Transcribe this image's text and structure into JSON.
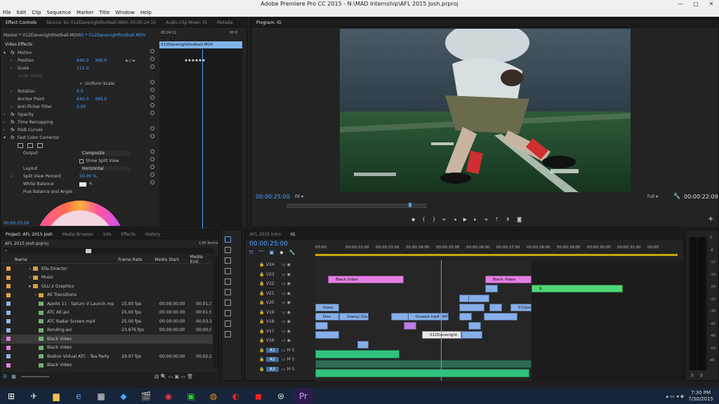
{
  "window": {
    "title": "Adobe Premiere Pro CC 2015 - N:\\MAD Internship\\AFL 2015 Josh.prproj",
    "controls": [
      "—",
      "□",
      "✕"
    ]
  },
  "menu": [
    "File",
    "Edit",
    "Clip",
    "Sequence",
    "Marker",
    "Title",
    "Window",
    "Help"
  ],
  "effect_controls": {
    "tabs": [
      "Effect Controls",
      "Source: IG: 012Danenightfootball.MOV: 00:00:24:10",
      "Audio Clip Mixer: IG",
      "Metada"
    ],
    "master": "Master * 012Danenightfootball.MOV",
    "clip": "IG * 012Danenightfootball.MOV",
    "mini_time": "00:24:12",
    "mini_time2": "00:0",
    "mini_clip": "012Danenightfootball.MOV",
    "section": "Video Effects",
    "props": [
      {
        "name": "Motion",
        "fx": true,
        "value": "",
        "value2": ""
      },
      {
        "name": "Position",
        "fx": false,
        "value": "640.0",
        "value2": "360.0"
      },
      {
        "name": "Scale",
        "fx": false,
        "value": "111.0",
        "value2": ""
      },
      {
        "name": "Scale Width",
        "fx": false,
        "value": "",
        "value2": ""
      },
      {
        "name": "Uniform Scale",
        "fx": false,
        "value": "",
        "value2": ""
      },
      {
        "name": "Rotation",
        "fx": false,
        "value": "0.0",
        "value2": ""
      },
      {
        "name": "Anchor Point",
        "fx": false,
        "value": "640.0",
        "value2": "360.0"
      },
      {
        "name": "Anti-flicker Filter",
        "fx": false,
        "value": "0.00",
        "value2": ""
      },
      {
        "name": "Opacity",
        "fx": true,
        "value": "",
        "value2": ""
      },
      {
        "name": "Time Remapping",
        "fx": true,
        "value": "",
        "value2": ""
      },
      {
        "name": "RGB Curves",
        "fx": true,
        "value": "",
        "value2": ""
      },
      {
        "name": "Fast Color Corrector",
        "fx": true,
        "value": "",
        "value2": ""
      }
    ],
    "output_label": "Output",
    "output_value": "Composite",
    "show_split": "Show Split View",
    "layout_label": "Layout",
    "layout_value": "Horizontal",
    "split_percent_label": "Split View Percent",
    "split_percent_value": "50.00 %",
    "white_balance": "White Balance",
    "hue_balance": "Hue Balance and Angle",
    "timecode": "00:00:25:00"
  },
  "program": {
    "title": "Program: IG",
    "timecode": "00:00:25:00",
    "fit": "Fit",
    "full": "Full",
    "duration": "00:00:22:09"
  },
  "project": {
    "tabs": [
      "Project: AFL 2015 Josh",
      "Media Browser",
      "Info",
      "Effects",
      "History"
    ],
    "file": "AFL 2015 Josh.prproj",
    "items": "136 Items",
    "columns": [
      "Name",
      "Frame Rate",
      "Media Start",
      "Media End"
    ],
    "rows": [
      {
        "indent": 3,
        "type": "folder",
        "name": "Ella Director",
        "fps": "",
        "start": "",
        "end": "",
        "color": "#e8a23a"
      },
      {
        "indent": 3,
        "type": "folder",
        "name": "Music",
        "fps": "",
        "start": "",
        "end": "",
        "color": "#e8a23a"
      },
      {
        "indent": 3,
        "type": "folder",
        "name": "OLU 2 Graphics",
        "fps": "",
        "start": "",
        "end": "",
        "color": "#e8a23a"
      },
      {
        "indent": 4,
        "type": "folder",
        "name": "AE Transitions",
        "fps": "",
        "start": "",
        "end": "",
        "color": "#e8a23a"
      },
      {
        "indent": 4,
        "type": "file",
        "name": "Apollo 11 - Saturn V Launch.mp",
        "fps": "15.00 fps",
        "start": "00;00;00;00",
        "end": "00;01;3",
        "color": "#8db4e8"
      },
      {
        "indent": 4,
        "type": "file",
        "name": "ATC AE.avi",
        "fps": "25.00 fps",
        "start": "00:00:00:00",
        "end": "00:01:0",
        "color": "#8db4e8"
      },
      {
        "indent": 4,
        "type": "file",
        "name": "ATC Radar Screen.mp4",
        "fps": "25.00 fps",
        "start": "00:00:00:00",
        "end": "00:03:1",
        "color": "#8db4e8"
      },
      {
        "indent": 4,
        "type": "file",
        "name": "Bending.avi",
        "fps": "23.976 fps",
        "start": "00;00;00;00",
        "end": "00;00;0",
        "color": "#8db4e8"
      },
      {
        "indent": 4,
        "type": "file",
        "name": "Black Video",
        "fps": "",
        "start": "",
        "end": "",
        "color": "#e57fe3"
      },
      {
        "indent": 4,
        "type": "file",
        "name": "Black Video",
        "fps": "",
        "start": "",
        "end": "",
        "color": "#e57fe3"
      },
      {
        "indent": 4,
        "type": "file",
        "name": "Boston Virtual ATC - Tea Party",
        "fps": "29.97 fps",
        "start": "00;00;00;00",
        "end": "00;02;2",
        "color": "#8db4e8"
      },
      {
        "indent": 4,
        "type": "file",
        "name": "Black Video",
        "fps": "",
        "start": "",
        "end": "",
        "color": "#e57fe3"
      }
    ]
  },
  "timeline": {
    "tabs": [
      "AFL 2015 Intro",
      "IG"
    ],
    "timecode": "00:00:25:00",
    "ruler": [
      "00:00",
      "00:00:22:00",
      "00:00:23:00",
      "00:00:24:00",
      "00:00:25:00",
      "00:00:26:00",
      "00:00:27:00",
      "00:00:28:00",
      "00:00:29:00",
      "00:00:30:00",
      "00:00:31:00",
      "00:00"
    ],
    "tracks": [
      "V24",
      "V23",
      "V22",
      "V21",
      "V20",
      "V19",
      "V18",
      "V17",
      "V16",
      "A1",
      "A2",
      "A3"
    ],
    "clips": {
      "bv1": "Black Video",
      "bv2": "Black Video",
      "nine": "9",
      "glass1": "Glass",
      "dou": "Dou",
      "glassy": "Glassy Gla",
      "graze": "Graze2.mp4 [40%",
      "jos": "015Jos",
      "dane": "012Danenight"
    }
  },
  "meter": {
    "labels": [
      "0",
      "-6",
      "-12",
      "-18",
      "-24",
      "-30",
      "-36",
      "-42",
      "-48",
      "-54",
      "dB"
    ],
    "s_left": "S",
    "s_right": "S"
  },
  "taskbar": {
    "time": "7:30 PM",
    "date": "7/30/2015"
  }
}
